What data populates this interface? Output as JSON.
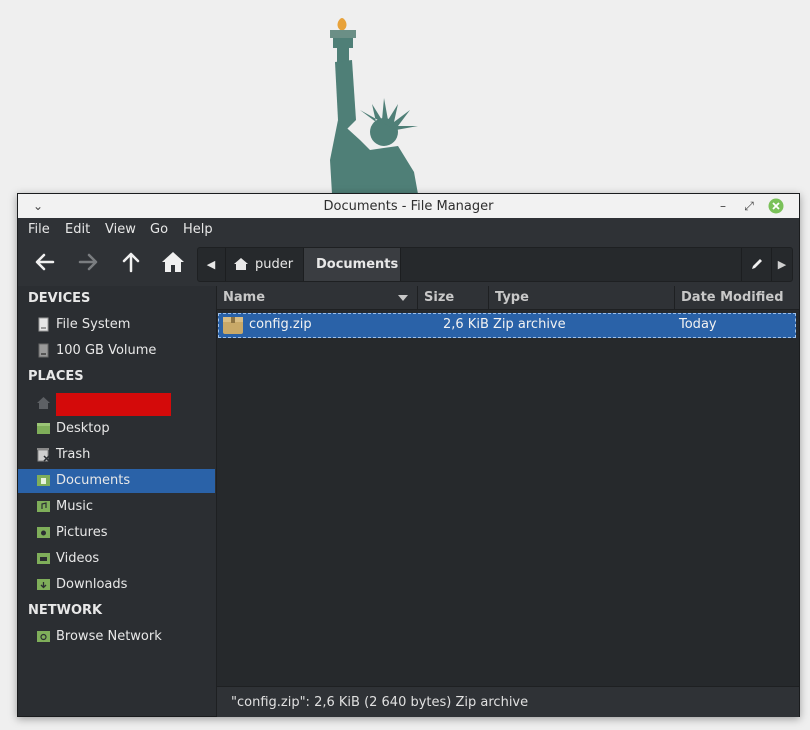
{
  "window": {
    "title": "Documents - File Manager"
  },
  "menu": [
    "File",
    "Edit",
    "View",
    "Go",
    "Help"
  ],
  "toolbar": {
    "back_icon": "arrow-left-icon",
    "forward_icon": "arrow-right-icon",
    "up_icon": "arrow-up-icon",
    "home_icon": "home-icon"
  },
  "pathbar": {
    "home": "puder",
    "current": "Documents"
  },
  "sidebar": {
    "devices_title": "DEVICES",
    "devices": [
      "File System",
      "100 GB Volume"
    ],
    "places_title": "PLACES",
    "places": [
      "Desktop",
      "Trash",
      "Documents",
      "Music",
      "Pictures",
      "Videos",
      "Downloads"
    ],
    "network_title": "NETWORK",
    "network": [
      "Browse Network"
    ]
  },
  "columns": {
    "name": "Name",
    "size": "Size",
    "type": "Type",
    "modified": "Date Modified"
  },
  "files": [
    {
      "name": "config.zip",
      "size": "2,6 KiB",
      "type": "Zip archive",
      "modified": "Today"
    }
  ],
  "status": "\"config.zip\": 2,6 KiB (2 640 bytes) Zip archive",
  "colors": {
    "accent": "#2a62a8",
    "folder": "#7fae5a",
    "background": "#2b2e32"
  }
}
